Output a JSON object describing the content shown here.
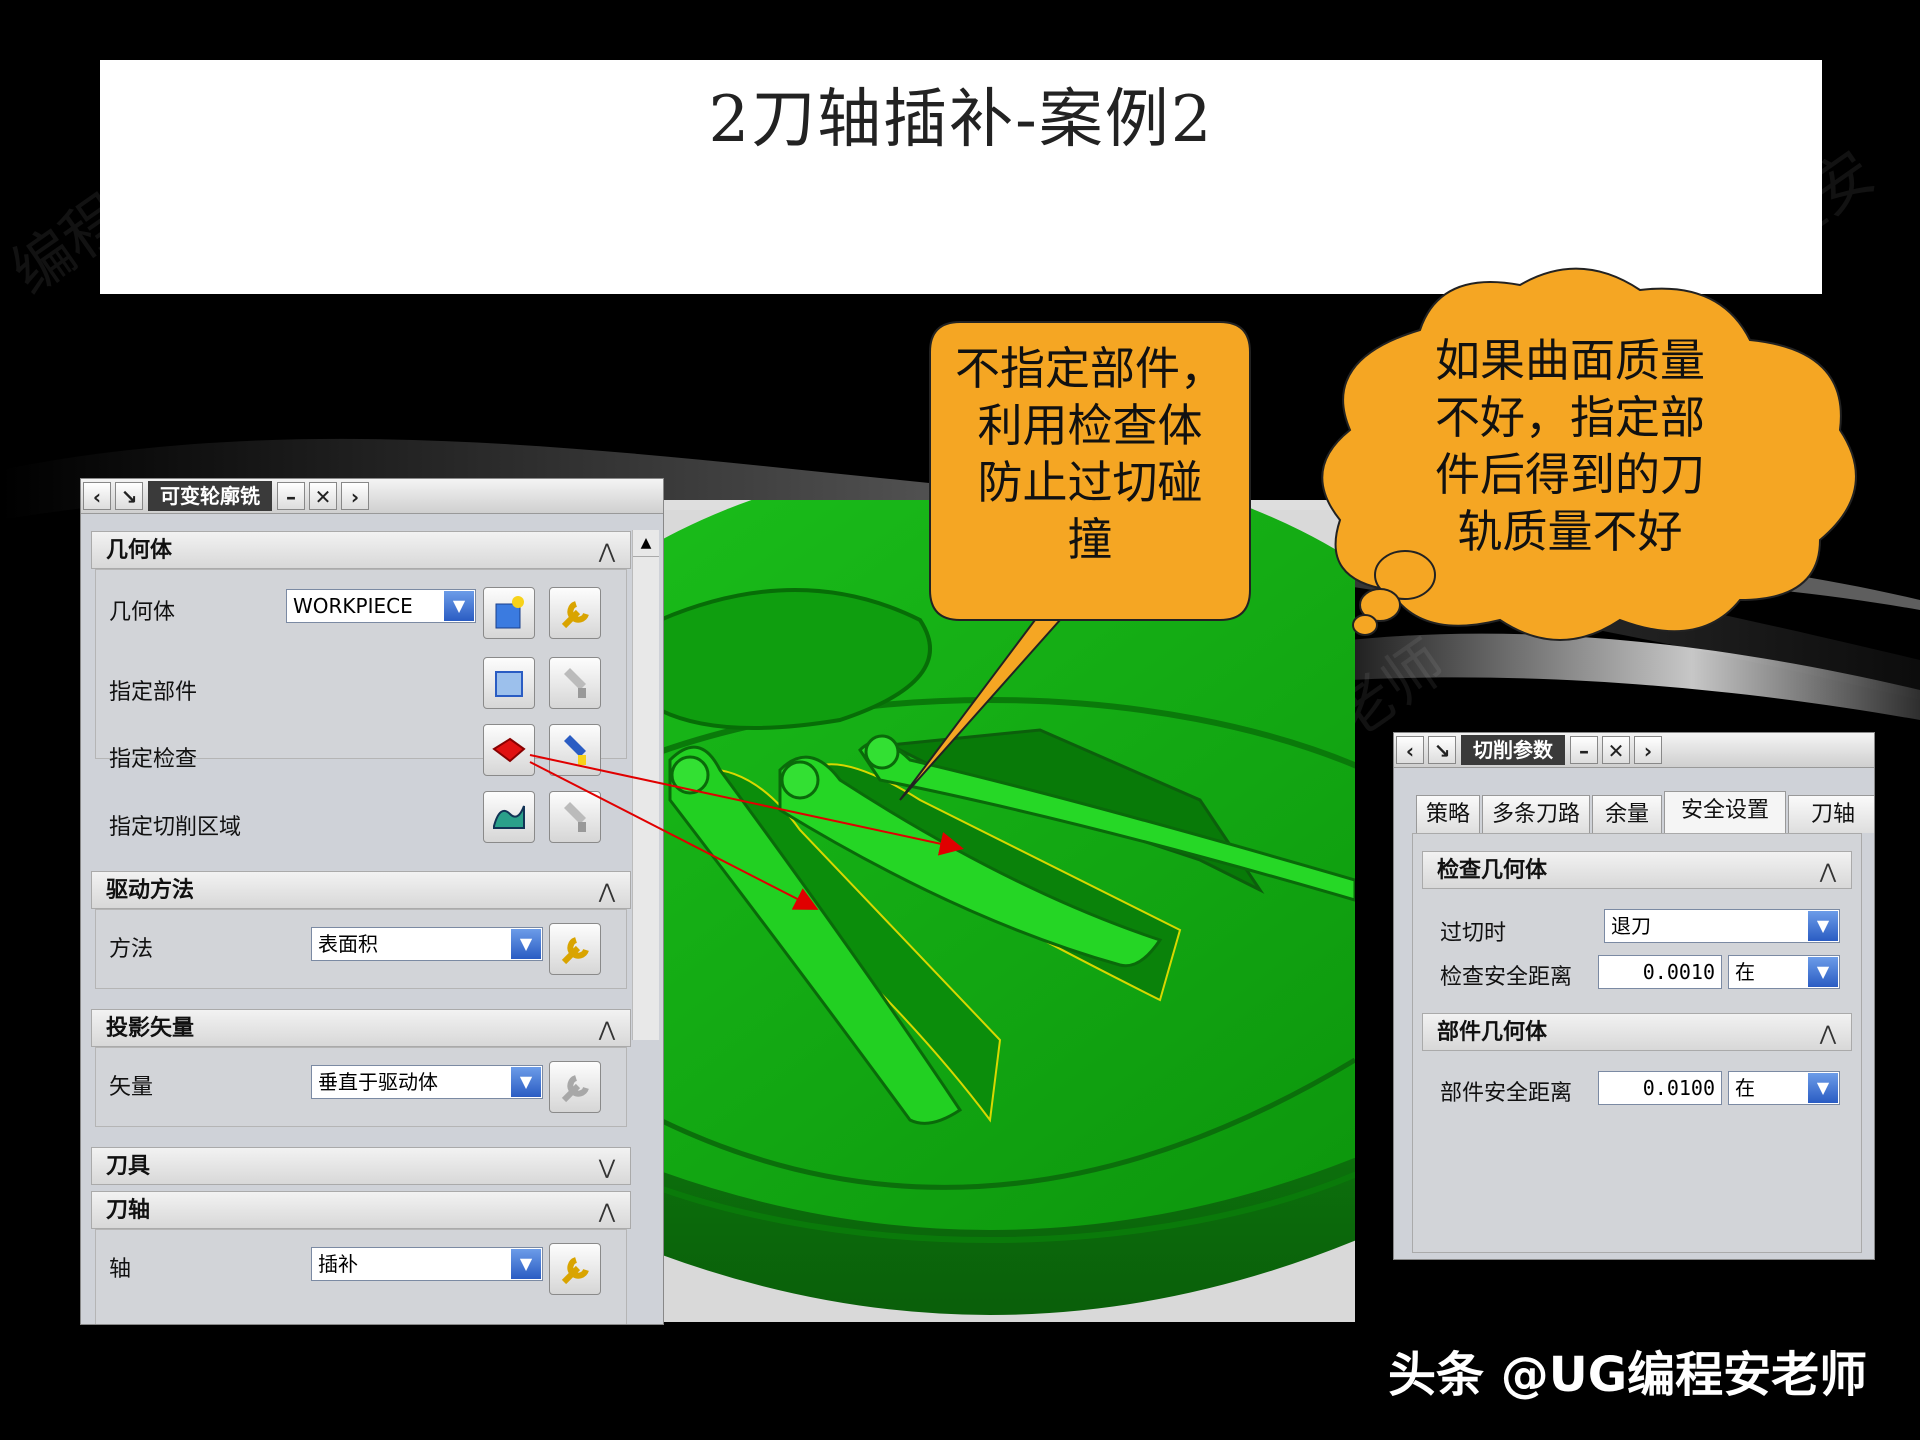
{
  "slide": {
    "title": "2刀轴插补-案例2"
  },
  "callouts": {
    "speech_lines": [
      "不指定部件，",
      "利用检查体",
      "防止过切碰",
      "撞"
    ],
    "thought_lines": [
      "如果曲面质量",
      "不好，指定部",
      "件后得到的刀",
      "轨质量不好"
    ],
    "speech_color": "#f5a623",
    "thought_color": "#f5a623"
  },
  "dialog_main": {
    "title": "可变轮廓铣",
    "sections": {
      "geometry": {
        "header": "几何体",
        "geometry_label": "几何体",
        "geometry_value": "WORKPIECE",
        "specify_part_label": "指定部件",
        "specify_check_label": "指定检查",
        "specify_cut_area_label": "指定切削区域"
      },
      "drive": {
        "header": "驱动方法",
        "method_label": "方法",
        "method_value": "表面积"
      },
      "projection": {
        "header": "投影矢量",
        "vector_label": "矢量",
        "vector_value": "垂直于驱动体"
      },
      "tool": {
        "header": "刀具"
      },
      "tool_axis": {
        "header": "刀轴",
        "axis_label": "轴",
        "axis_value": "插补"
      }
    }
  },
  "dialog_cut": {
    "title": "切削参数",
    "tabs": [
      "策略",
      "多条刀路",
      "余量",
      "安全设置",
      "刀轴"
    ],
    "active_tab": "安全设置",
    "check_section": {
      "header": "检查几何体",
      "overcut_label": "过切时",
      "overcut_value": "退刀",
      "check_clearance_label": "检查安全距离",
      "check_clearance_value": "0.0010",
      "check_clearance_unit": "在"
    },
    "part_section": {
      "header": "部件几何体",
      "part_clearance_label": "部件安全距离",
      "part_clearance_value": "0.0100",
      "part_clearance_unit": "在"
    }
  },
  "footer": {
    "text": "头条 @UG编程安老师"
  },
  "colors": {
    "model_green": "#1fcf1f",
    "combo_arrow": "#2a5cc3",
    "annotation_arrow": "#e00000"
  }
}
